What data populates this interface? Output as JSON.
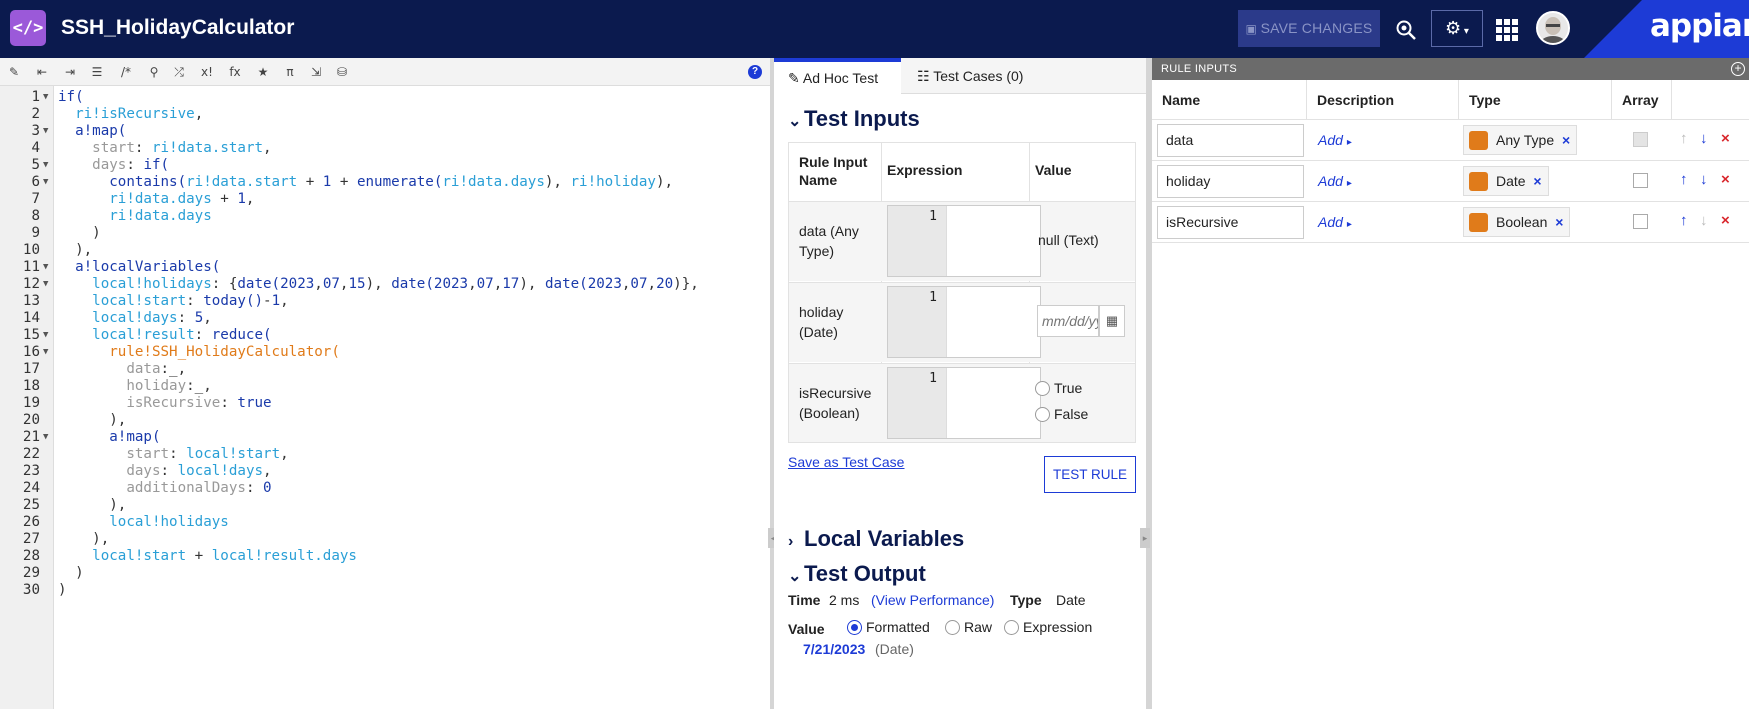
{
  "header": {
    "logo_glyph": "</>",
    "title": "SSH_HolidayCalculator",
    "save_label": "SAVE CHANGES",
    "brand": "appian"
  },
  "editor": {
    "toolbar_icons": [
      "wand-icon",
      "outdent-icon",
      "indent-icon",
      "list-icon",
      "comment-icon",
      "search-icon",
      "shuffle-icon",
      "variable-icon",
      "function-icon",
      "star-icon",
      "pi-icon",
      "export-icon",
      "query-icon"
    ],
    "toolbar_glyphs": [
      "✎",
      "⇤",
      "⇥",
      "☰",
      "/*",
      "⚲",
      "⤮",
      "x!",
      "fx",
      "★",
      "π",
      "⇲",
      "⛁"
    ],
    "help_glyph": "?",
    "lines": [
      {
        "n": "1",
        "fold": true,
        "parts": [
          [
            "kw",
            "if("
          ]
        ]
      },
      {
        "n": "2",
        "parts": [
          [
            "op",
            "  "
          ],
          [
            "va",
            "ri!isRecursive"
          ],
          [
            "op",
            ","
          ]
        ]
      },
      {
        "n": "3",
        "fold": true,
        "parts": [
          [
            "op",
            "  "
          ],
          [
            "kw",
            "a!map("
          ]
        ]
      },
      {
        "n": "4",
        "parts": [
          [
            "op",
            "    "
          ],
          [
            "dim",
            "start"
          ],
          [
            "op",
            ": "
          ],
          [
            "va",
            "ri!data.start"
          ],
          [
            "op",
            ","
          ]
        ]
      },
      {
        "n": "5",
        "fold": true,
        "parts": [
          [
            "op",
            "    "
          ],
          [
            "dim",
            "days"
          ],
          [
            "op",
            ": "
          ],
          [
            "kw",
            "if("
          ]
        ]
      },
      {
        "n": "6",
        "fold": true,
        "parts": [
          [
            "op",
            "      "
          ],
          [
            "kw",
            "contains("
          ],
          [
            "va",
            "ri!data.start"
          ],
          [
            "op",
            " + "
          ],
          [
            "nu",
            "1"
          ],
          [
            "op",
            " + "
          ],
          [
            "kw",
            "enumerate("
          ],
          [
            "va",
            "ri!data.days"
          ],
          [
            "op",
            "), "
          ],
          [
            "va",
            "ri!holiday"
          ],
          [
            "op",
            "),"
          ]
        ]
      },
      {
        "n": "7",
        "parts": [
          [
            "op",
            "      "
          ],
          [
            "va",
            "ri!data.days"
          ],
          [
            "op",
            " + "
          ],
          [
            "nu",
            "1"
          ],
          [
            "op",
            ","
          ]
        ]
      },
      {
        "n": "8",
        "parts": [
          [
            "op",
            "      "
          ],
          [
            "va",
            "ri!data.days"
          ]
        ]
      },
      {
        "n": "9",
        "parts": [
          [
            "op",
            "    )"
          ]
        ]
      },
      {
        "n": "10",
        "parts": [
          [
            "op",
            "  ),"
          ]
        ]
      },
      {
        "n": "11",
        "fold": true,
        "parts": [
          [
            "op",
            "  "
          ],
          [
            "kw",
            "a!localVariables("
          ]
        ]
      },
      {
        "n": "12",
        "fold": true,
        "parts": [
          [
            "op",
            "    "
          ],
          [
            "va",
            "local!holidays"
          ],
          [
            "op",
            ": {"
          ],
          [
            "kw",
            "date("
          ],
          [
            "nu",
            "2023"
          ],
          [
            "op",
            ","
          ],
          [
            "nu",
            "07"
          ],
          [
            "op",
            ","
          ],
          [
            "nu",
            "15"
          ],
          [
            "op",
            "), "
          ],
          [
            "kw",
            "date("
          ],
          [
            "nu",
            "2023"
          ],
          [
            "op",
            ","
          ],
          [
            "nu",
            "07"
          ],
          [
            "op",
            ","
          ],
          [
            "nu",
            "17"
          ],
          [
            "op",
            "), "
          ],
          [
            "kw",
            "date("
          ],
          [
            "nu",
            "2023"
          ],
          [
            "op",
            ","
          ],
          [
            "nu",
            "07"
          ],
          [
            "op",
            ","
          ],
          [
            "nu",
            "20"
          ],
          [
            "op",
            ")},"
          ]
        ]
      },
      {
        "n": "13",
        "parts": [
          [
            "op",
            "    "
          ],
          [
            "va",
            "local!start"
          ],
          [
            "op",
            ": "
          ],
          [
            "kw",
            "today()"
          ],
          [
            "op",
            "-"
          ],
          [
            "nu",
            "1"
          ],
          [
            "op",
            ","
          ]
        ]
      },
      {
        "n": "14",
        "parts": [
          [
            "op",
            "    "
          ],
          [
            "va",
            "local!days"
          ],
          [
            "op",
            ": "
          ],
          [
            "nu",
            "5"
          ],
          [
            "op",
            ","
          ]
        ]
      },
      {
        "n": "15",
        "fold": true,
        "parts": [
          [
            "op",
            "    "
          ],
          [
            "va",
            "local!result"
          ],
          [
            "op",
            ": "
          ],
          [
            "kw",
            "reduce("
          ]
        ]
      },
      {
        "n": "16",
        "fold": true,
        "parts": [
          [
            "op",
            "      "
          ],
          [
            "ru",
            "rule!SSH_HolidayCalculator("
          ]
        ]
      },
      {
        "n": "17",
        "parts": [
          [
            "op",
            "        "
          ],
          [
            "dim",
            "data"
          ],
          [
            "op",
            ":_,"
          ]
        ]
      },
      {
        "n": "18",
        "parts": [
          [
            "op",
            "        "
          ],
          [
            "dim",
            "holiday"
          ],
          [
            "op",
            ":_,"
          ]
        ]
      },
      {
        "n": "19",
        "parts": [
          [
            "op",
            "        "
          ],
          [
            "dim",
            "isRecursive"
          ],
          [
            "op",
            ": "
          ],
          [
            "kw",
            "true"
          ]
        ]
      },
      {
        "n": "20",
        "parts": [
          [
            "op",
            "      ),"
          ]
        ]
      },
      {
        "n": "21",
        "fold": true,
        "parts": [
          [
            "op",
            "      "
          ],
          [
            "kw",
            "a!map("
          ]
        ]
      },
      {
        "n": "22",
        "parts": [
          [
            "op",
            "        "
          ],
          [
            "dim",
            "start"
          ],
          [
            "op",
            ": "
          ],
          [
            "va",
            "local!start"
          ],
          [
            "op",
            ","
          ]
        ]
      },
      {
        "n": "23",
        "parts": [
          [
            "op",
            "        "
          ],
          [
            "dim",
            "days"
          ],
          [
            "op",
            ": "
          ],
          [
            "va",
            "local!days"
          ],
          [
            "op",
            ","
          ]
        ]
      },
      {
        "n": "24",
        "parts": [
          [
            "op",
            "        "
          ],
          [
            "dim",
            "additionalDays"
          ],
          [
            "op",
            ": "
          ],
          [
            "nu",
            "0"
          ]
        ]
      },
      {
        "n": "25",
        "parts": [
          [
            "op",
            "      ),"
          ]
        ]
      },
      {
        "n": "26",
        "parts": [
          [
            "op",
            "      "
          ],
          [
            "va",
            "local!holidays"
          ]
        ]
      },
      {
        "n": "27",
        "parts": [
          [
            "op",
            "    ),"
          ]
        ]
      },
      {
        "n": "28",
        "parts": [
          [
            "op",
            "    "
          ],
          [
            "va",
            "local!start"
          ],
          [
            "op",
            " + "
          ],
          [
            "va",
            "local!result.days"
          ]
        ]
      },
      {
        "n": "29",
        "parts": [
          [
            "op",
            "  )"
          ]
        ]
      },
      {
        "n": "30",
        "parts": [
          [
            "op",
            ")"
          ]
        ]
      }
    ]
  },
  "tabs": {
    "adhoc_icon": "✎",
    "adhoc": "Ad Hoc Test",
    "cases_icon": "☷",
    "cases": "Test Cases (0)"
  },
  "test_inputs": {
    "title": "Test Inputs",
    "col_name": "Rule Input Name",
    "col_expr": "Expression",
    "col_value": "Value",
    "rows": [
      {
        "name": "data (Any Type)",
        "line": "1",
        "value": "null (Text)"
      },
      {
        "name": "holiday (Date)",
        "line": "1",
        "placeholder": "mm/dd/yyyy"
      },
      {
        "name": "isRecursive (Boolean)",
        "line": "1",
        "opt_true": "True",
        "opt_false": "False"
      }
    ],
    "save_case": "Save as Test Case",
    "test_rule": "TEST RULE"
  },
  "local_variables": {
    "title": "Local Variables"
  },
  "test_output": {
    "title": "Test Output",
    "time_label": "Time",
    "time_value": "2 ms",
    "perf_link": "(View Performance)",
    "type_label": "Type",
    "type_value": "Date",
    "value_label": "Value",
    "opt_formatted": "Formatted",
    "opt_raw": "Raw",
    "opt_expression": "Expression",
    "result": "7/21/2023",
    "result_type": "(Date)"
  },
  "rule_inputs": {
    "title": "RULE INPUTS",
    "col_name": "Name",
    "col_desc": "Description",
    "col_type": "Type",
    "col_array": "Array",
    "add_label": "Add",
    "rows": [
      {
        "name": "data",
        "type": "Any Type"
      },
      {
        "name": "holiday",
        "type": "Date"
      },
      {
        "name": "isRecursive",
        "type": "Boolean"
      }
    ]
  },
  "colors": {
    "header_bg": "#0b1a4e",
    "accent": "#1d3bd6",
    "logo": "#9b59d9",
    "type_icon": "#e07b1a",
    "delete": "#d9262c"
  }
}
